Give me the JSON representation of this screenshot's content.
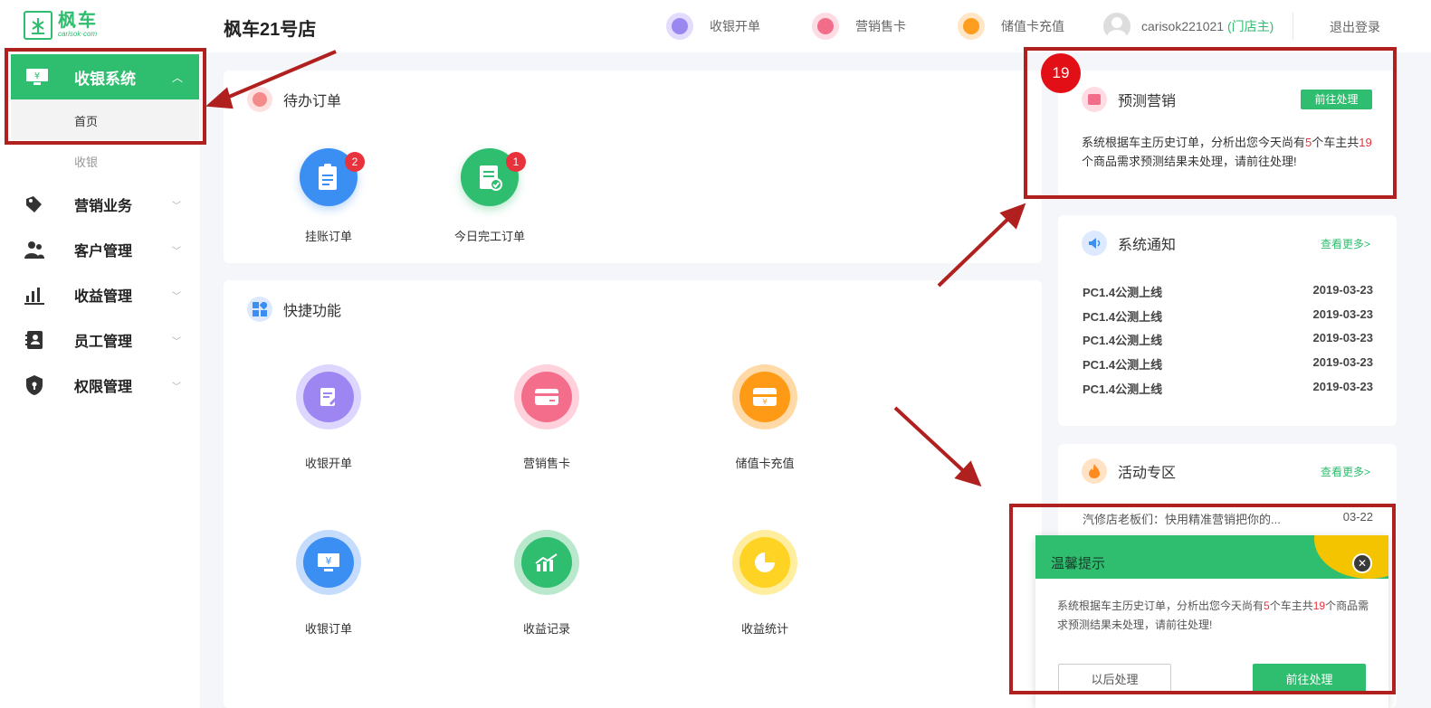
{
  "brand": {
    "name": "枫车",
    "domain": "carisok·com"
  },
  "sidebar": {
    "active_group": "收银系统",
    "sub_items": [
      "首页",
      "收银"
    ],
    "groups": [
      "营销业务",
      "客户管理",
      "收益管理",
      "员工管理",
      "权限管理"
    ]
  },
  "header": {
    "store_name": "枫车21号店",
    "actions": [
      "收银开单",
      "营销售卡",
      "储值卡充值"
    ],
    "user": "carisok221021",
    "role": "(门店主)",
    "logout": "退出登录"
  },
  "pending": {
    "title": "待办订单",
    "items": [
      {
        "label": "挂账订单",
        "count": "2"
      },
      {
        "label": "今日完工订单",
        "count": "1"
      }
    ]
  },
  "quick": {
    "title": "快捷功能",
    "items": [
      "收银开单",
      "营销售卡",
      "储值卡充值",
      "收银订单",
      "收益记录",
      "收益统计"
    ]
  },
  "forecast": {
    "count_badge": "19",
    "title": "预测营销",
    "button": "前往处理",
    "text_a": "系统根据车主历史订单，分析出您今天尚有",
    "num_owners": "5",
    "text_b": "个车主共",
    "num_items": "19",
    "text_c": "个商品需求预测结果未处理，请前往处理!"
  },
  "notices": {
    "title": "系统通知",
    "more": "查看更多>",
    "rows": [
      {
        "title": "PC1.4公测上线",
        "date": "2019-03-23"
      },
      {
        "title": "PC1.4公测上线",
        "date": "2019-03-23"
      },
      {
        "title": "PC1.4公测上线",
        "date": "2019-03-23"
      },
      {
        "title": "PC1.4公测上线",
        "date": "2019-03-23"
      },
      {
        "title": "PC1.4公测上线",
        "date": "2019-03-23"
      }
    ]
  },
  "activity": {
    "title": "活动专区",
    "more": "查看更多>",
    "row": {
      "title": "汽修店老板们：快用精准营销把你的...",
      "date": "03-22"
    }
  },
  "popup": {
    "title": "温馨提示",
    "text_a": "系统根据车主历史订单，分析出您今天尚有",
    "num_owners": "5",
    "text_b": "个车主共",
    "num_items": "19",
    "text_c": "个商品需求预测结果未处理，请前往处理!",
    "later": "以后处理",
    "go": "前往处理"
  },
  "colors": {
    "brand_green": "#2fbd6f",
    "badge_red": "#e8323c",
    "annotation_red": "#b0201e"
  }
}
